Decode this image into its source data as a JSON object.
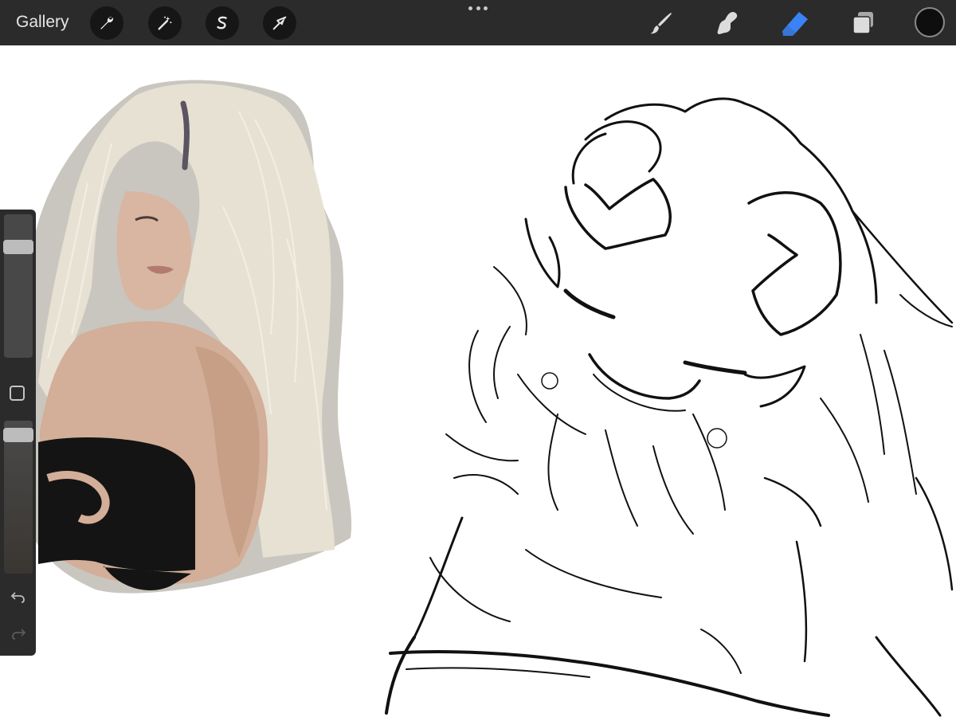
{
  "toolbar": {
    "gallery_label": "Gallery",
    "left_actions": [
      {
        "name": "actions",
        "icon": "wrench-icon"
      },
      {
        "name": "adjustments",
        "icon": "magic-wand-icon"
      },
      {
        "name": "selection",
        "icon": "selection-s-icon"
      },
      {
        "name": "transform",
        "icon": "arrow-cursor-icon"
      }
    ],
    "right_tools": [
      {
        "name": "brush",
        "icon": "brush-icon",
        "active": false
      },
      {
        "name": "smudge",
        "icon": "smudge-icon",
        "active": false
      },
      {
        "name": "eraser",
        "icon": "eraser-icon",
        "active": true
      },
      {
        "name": "layers",
        "icon": "layers-icon",
        "active": false
      }
    ],
    "current_color": "#0e0e0e",
    "active_tool_color": "#3a82f6"
  },
  "sidebar": {
    "brush_size_level": 0.8,
    "opacity_level": 0.95,
    "icons": [
      "square-icon",
      "undo-icon",
      "redo-icon"
    ]
  },
  "canvas": {
    "background": "#ffffff",
    "layers": [
      {
        "name": "reference-photo",
        "description_icon": "photo"
      },
      {
        "name": "line-sketch",
        "description_icon": "sketch"
      }
    ]
  }
}
